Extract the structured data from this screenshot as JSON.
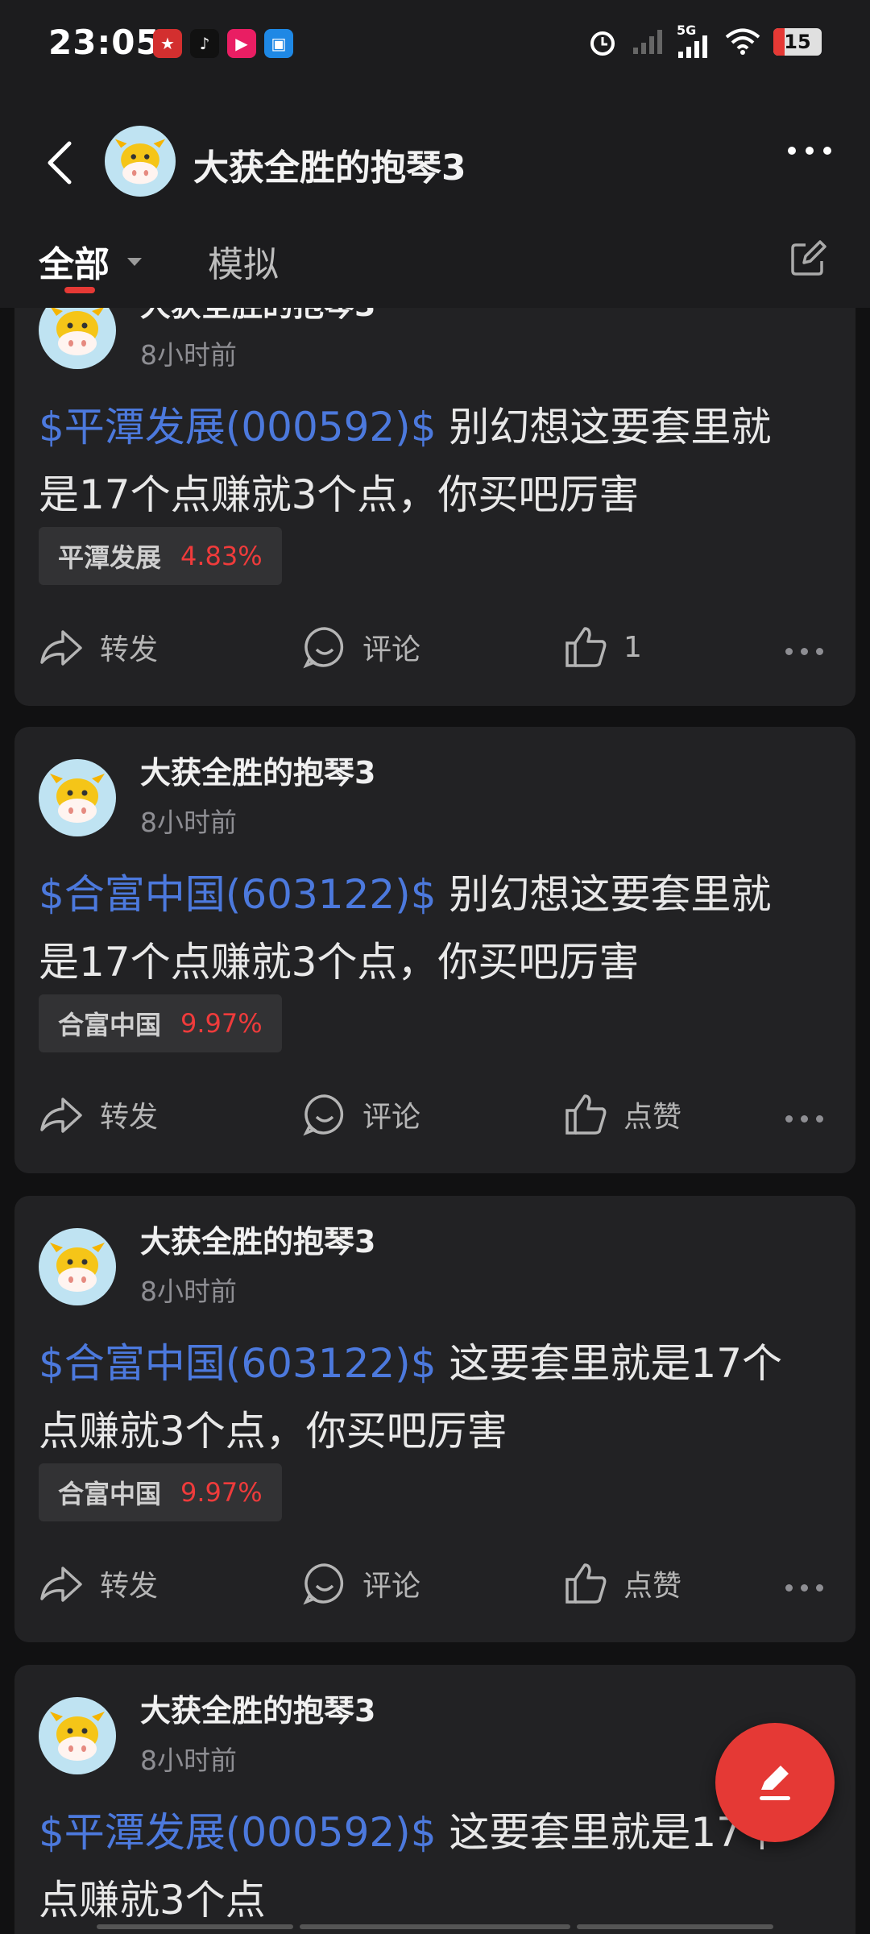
{
  "status_bar": {
    "time": "23:05",
    "battery": "15",
    "network": "5G"
  },
  "header": {
    "title": "大获全胜的抱琴3"
  },
  "tabs": {
    "all_label": "全部",
    "sim_label": "模拟"
  },
  "posts": [
    {
      "user": "大获全胜的抱琴3",
      "time": "8小时前",
      "stock_tag": "$平潭发展(000592)$",
      "text_line1": " 别幻想这要套里就",
      "text_line2": "是17个点赚就3个点，你买吧厉害",
      "chip_name": "平潭发展",
      "chip_pct": "4.83%",
      "share": "转发",
      "comment": "评论",
      "like": "1"
    },
    {
      "user": "大获全胜的抱琴3",
      "time": "8小时前",
      "stock_tag": "$合富中国(603122)$",
      "text_line1": " 别幻想这要套里就",
      "text_line2": "是17个点赚就3个点，你买吧厉害",
      "chip_name": "合富中国",
      "chip_pct": "9.97%",
      "share": "转发",
      "comment": "评论",
      "like": "点赞"
    },
    {
      "user": "大获全胜的抱琴3",
      "time": "8小时前",
      "stock_tag": "$合富中国(603122)$",
      "text_line1": " 这要套里就是17个",
      "text_line2": "点赚就3个点，你买吧厉害",
      "chip_name": "合富中国",
      "chip_pct": "9.97%",
      "share": "转发",
      "comment": "评论",
      "like": "点赞"
    },
    {
      "user": "大获全胜的抱琴3",
      "time": "8小时前",
      "stock_tag": "$平潭发展(000592)$",
      "text_line1": " 这要套里就是17个",
      "text_line2": "点赚就3个点"
    }
  ],
  "colors": {
    "background": "#111112",
    "card": "#222224",
    "stock_link": "#4c79dd",
    "gain_red": "#ef3b3b",
    "accent": "#e53935"
  },
  "icons": [
    "back-arrow-icon",
    "more-icon",
    "edit-icon",
    "share-icon",
    "comment-icon",
    "like-icon",
    "compose-icon"
  ]
}
